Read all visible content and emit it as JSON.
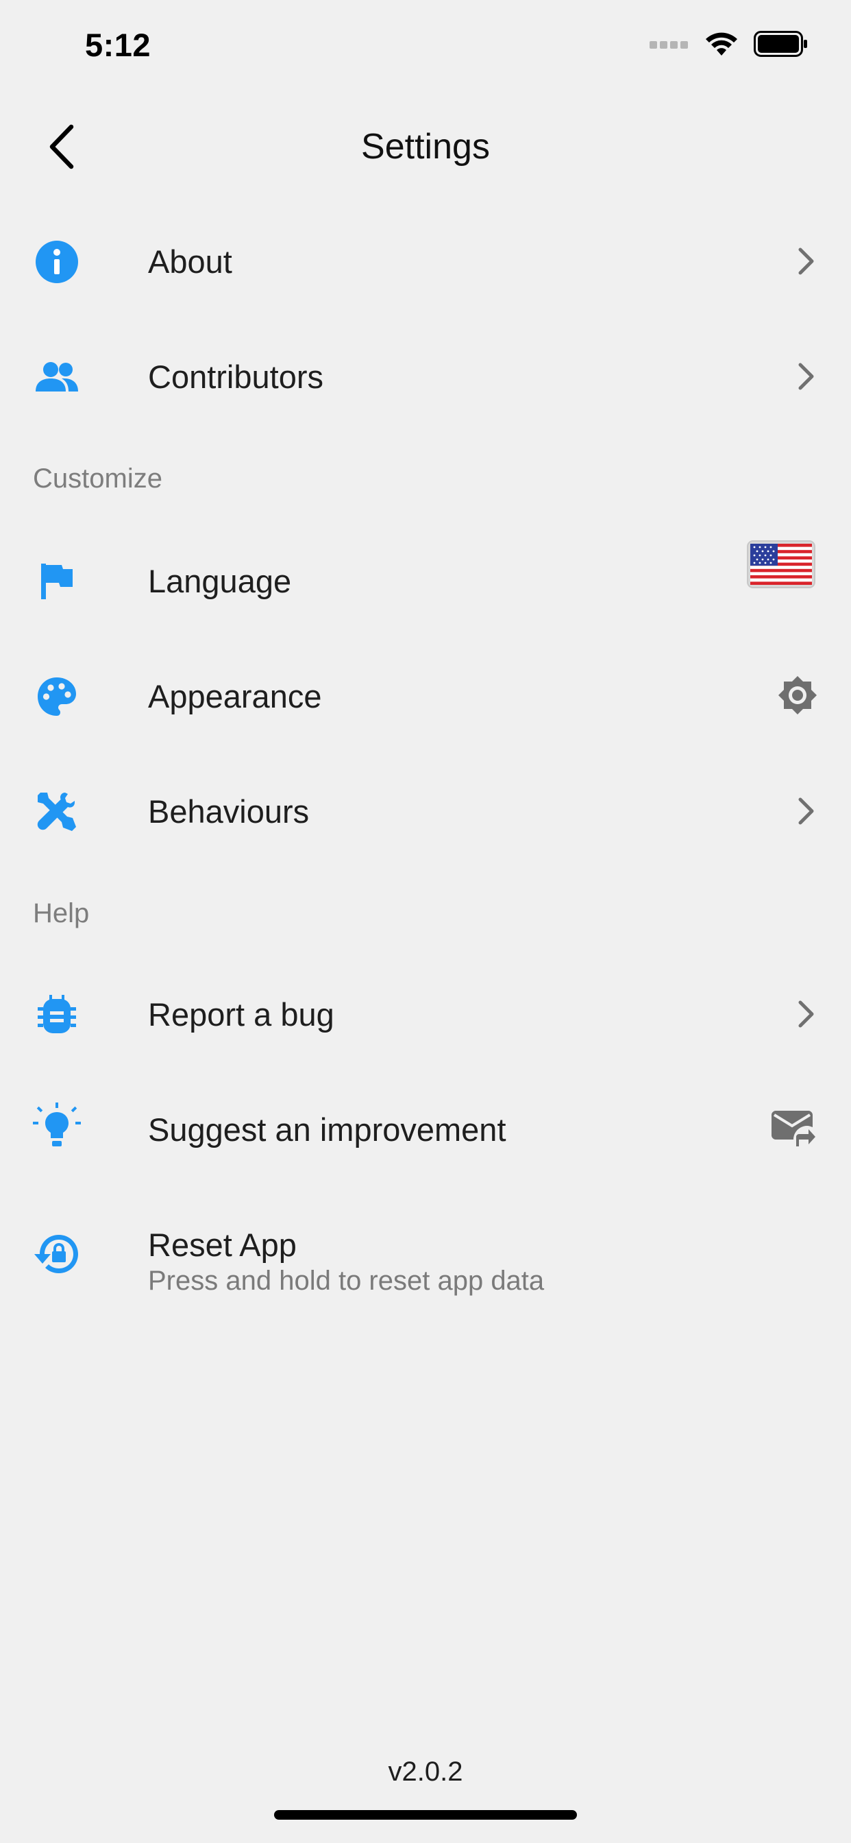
{
  "status_bar": {
    "time": "5:12",
    "icons": [
      "signal-icon",
      "wifi-icon",
      "battery-icon"
    ]
  },
  "nav": {
    "title": "Settings",
    "back_icon": "chevron-left-icon"
  },
  "accent_color": "#2196f3",
  "rows_top": [
    {
      "label": "About",
      "icon": "info-icon",
      "trailing": "chevron-right-icon"
    },
    {
      "label": "Contributors",
      "icon": "people-icon",
      "trailing": "chevron-right-icon"
    }
  ],
  "sections": {
    "customize": {
      "title": "Customize",
      "items": [
        {
          "label": "Language",
          "icon": "flag-icon",
          "trailing": "us-flag-icon"
        },
        {
          "label": "Appearance",
          "icon": "palette-icon",
          "trailing": "brightness-auto-icon"
        },
        {
          "label": "Behaviours",
          "icon": "tools-icon",
          "trailing": "chevron-right-icon"
        }
      ]
    },
    "help": {
      "title": "Help",
      "items": [
        {
          "label": "Report a bug",
          "icon": "bug-icon",
          "trailing": "chevron-right-icon"
        },
        {
          "label": "Suggest an improvement",
          "icon": "lightbulb-icon",
          "trailing": "email-forward-icon"
        },
        {
          "label": "Reset App",
          "sublabel": "Press and hold to reset app data",
          "icon": "lock-reset-icon"
        }
      ]
    }
  },
  "version": "v2.0.2"
}
